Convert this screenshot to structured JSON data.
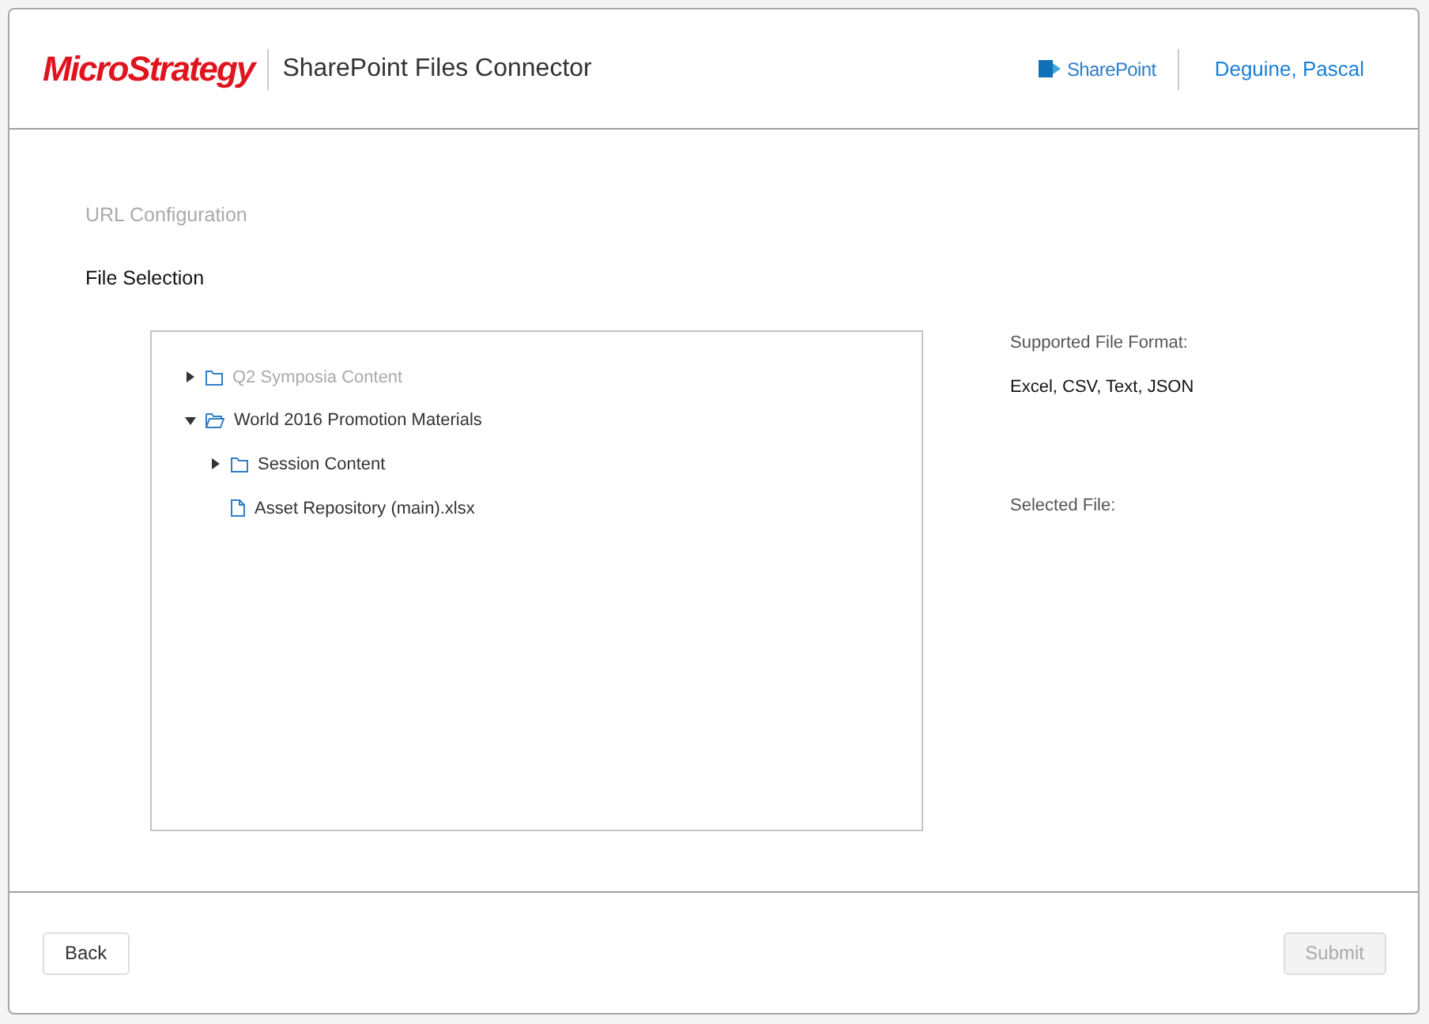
{
  "header": {
    "logo": "MicroStrategy",
    "title": "SharePoint Files Connector",
    "service": "SharePoint",
    "user": "Deguine, Pascal"
  },
  "steps": [
    {
      "label": "URL Configuration",
      "selected": false
    },
    {
      "label": "File Selection",
      "selected": true
    }
  ],
  "tree": [
    {
      "kind": "folder",
      "label": "Q2 Symposia Content",
      "expanded": false,
      "disabled": true
    },
    {
      "kind": "folder",
      "label": "World 2016 Promotion Materials",
      "expanded": true,
      "disabled": false,
      "children": [
        {
          "kind": "folder",
          "label": "Session Content",
          "expanded": false,
          "disabled": false
        },
        {
          "kind": "file",
          "label": "Asset Repository (main).xlsx",
          "disabled": false
        }
      ]
    }
  ],
  "info": {
    "formats_label": "Supported File Format:",
    "formats": "Excel, CSV, Text, JSON",
    "selected_label": "Selected File:"
  },
  "buttons": [
    {
      "label": "Back",
      "disabled": false
    },
    {
      "label": "Submit",
      "disabled": true
    }
  ]
}
